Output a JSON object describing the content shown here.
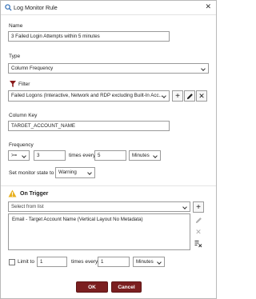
{
  "window": {
    "title": "Log Monitor Rule"
  },
  "name": {
    "label": "Name",
    "value": "3 Failed Login Attempts within 5 minutes"
  },
  "type": {
    "label": "Type",
    "value": "Column Frequency"
  },
  "filter": {
    "label": "Filter",
    "value": "Failed Logons (Interactive, Network and RDP excluding Built-In Acc..."
  },
  "column_key": {
    "label": "Column Key",
    "value": "TARGET_ACCOUNT_NAME"
  },
  "frequency": {
    "label": "Frequency",
    "operator": ">=",
    "count": "3",
    "times_every_label": "times every",
    "period": "5",
    "unit": "Minutes"
  },
  "monitor_state": {
    "label": "Set monitor state to",
    "value": "Warning"
  },
  "on_trigger": {
    "heading": "On Trigger",
    "select_placeholder": "Select from list",
    "actions": [
      "Email - Target Account Name (Vertical Layout No Metadata)"
    ]
  },
  "limit": {
    "label": "Limit to",
    "count": "1",
    "times_every_label": "times every",
    "period": "1",
    "unit": "Minutes"
  },
  "buttons": {
    "ok": "OK",
    "cancel": "Cancel"
  },
  "colors": {
    "accent": "#7b1f20",
    "warning": "#e8b020"
  }
}
